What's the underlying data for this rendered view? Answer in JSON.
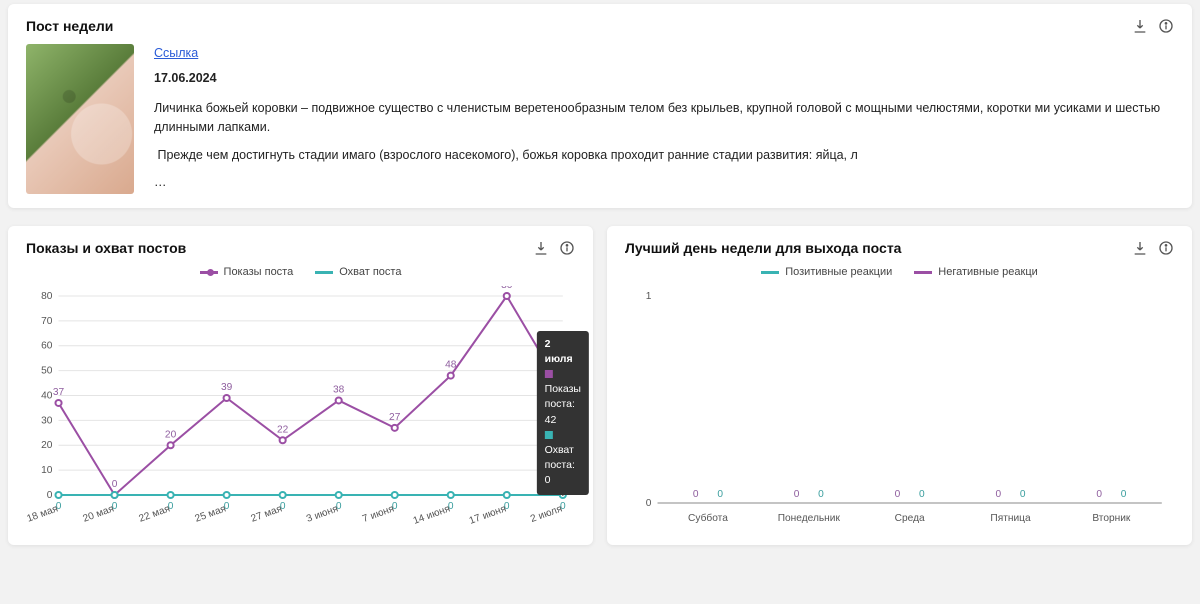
{
  "post_card": {
    "title": "Пост недели",
    "link_label": "Ссылка",
    "date": "17.06.2024",
    "para1": "Личинка божьей коровки – подвижное существо с членистым веретенообразным телом без крыльев, крупной головой с мощными челюстями, коротки ми усиками и шестью длинными лапками.",
    "para2": "⁣⁣⁣⁣⁣ Прежде чем достигнуть стадии имаго (взрослого насекомого), божья коровка проходит ранние стадии развития: яйца, л",
    "ellipsis": "…"
  },
  "chart1": {
    "title": "Показы и охват постов",
    "legend": {
      "a": "Показы поста",
      "b": "Охват поста"
    },
    "tooltip": {
      "date": "2 июля",
      "line1_label": "Показы поста:",
      "line1_val": "42",
      "line2_label": "Охват поста:",
      "line2_val": "0"
    }
  },
  "chart2": {
    "title": "Лучший день недели для выхода поста",
    "legend": {
      "a": "Позитивные реакции",
      "b": "Негативные реакци"
    }
  },
  "colors": {
    "purple": "#9b4fa4",
    "teal": "#39b3b3",
    "grid": "#e4e4e4",
    "axis": "#888"
  },
  "chart_data": [
    {
      "type": "line",
      "title": "Показы и охват постов",
      "categories": [
        "18 мая",
        "20 мая",
        "22 мая",
        "25 мая",
        "27 мая",
        "3 июня",
        "7 июня",
        "14 июня",
        "17 июня",
        "2 июля"
      ],
      "series": [
        {
          "name": "Показы поста",
          "color": "#9b4fa4",
          "values": [
            37,
            0,
            20,
            39,
            22,
            38,
            27,
            48,
            80,
            42
          ]
        },
        {
          "name": "Охват поста",
          "color": "#39b3b3",
          "values": [
            0,
            0,
            0,
            0,
            0,
            0,
            0,
            0,
            0,
            0
          ]
        }
      ],
      "ylim": [
        0,
        80
      ],
      "yticks": [
        0,
        10,
        20,
        30,
        40,
        50,
        60,
        70,
        80
      ]
    },
    {
      "type": "bar",
      "title": "Лучший день недели для выхода поста",
      "categories": [
        "Суббота",
        "Понедельник",
        "Среда",
        "Пятница",
        "Вторник"
      ],
      "series": [
        {
          "name": "Позитивные реакции",
          "color": "#39b3b3",
          "values": [
            0,
            0,
            0,
            0,
            0
          ]
        },
        {
          "name": "Негативные реакци",
          "color": "#9b4fa4",
          "values": [
            0,
            0,
            0,
            0,
            0
          ]
        }
      ],
      "ylim": [
        0,
        1
      ],
      "yticks": [
        0,
        1
      ]
    }
  ]
}
